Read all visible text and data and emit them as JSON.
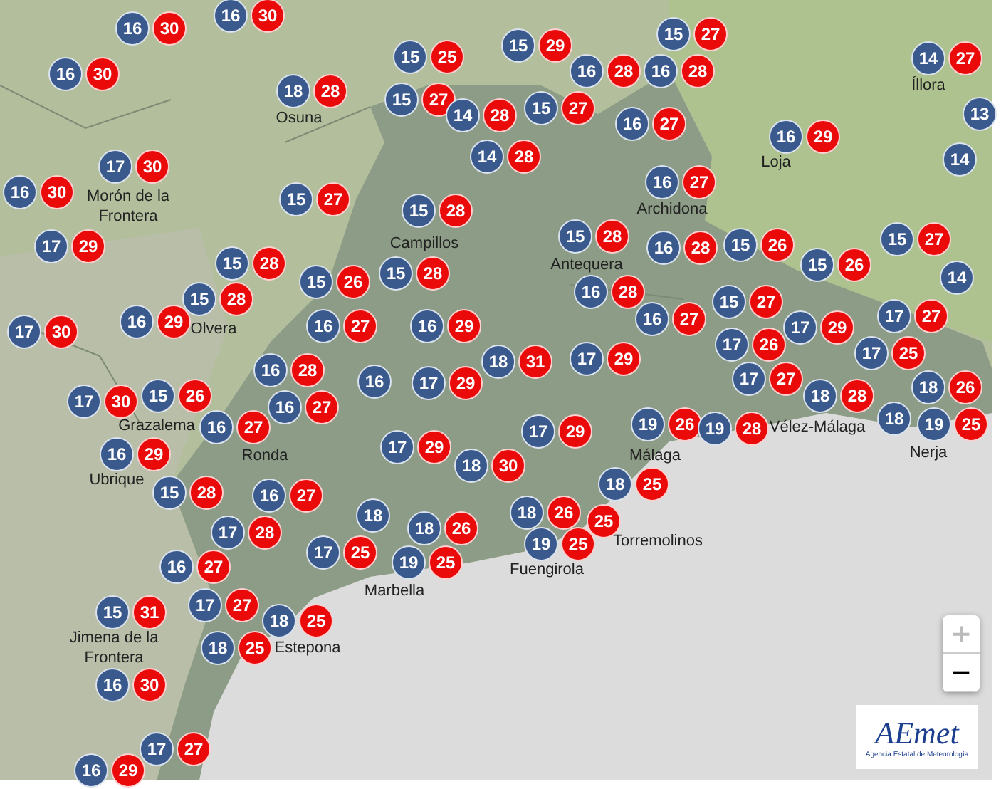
{
  "stations": [
    {
      "min": "16",
      "max": "30"
    },
    {
      "min": "16",
      "max": "30"
    },
    {
      "min": "16",
      "max": "30"
    },
    {
      "min": "18",
      "max": "28"
    },
    {
      "min": "15",
      "max": "25"
    },
    {
      "min": "15",
      "max": "29"
    },
    {
      "min": "15",
      "max": "27"
    },
    {
      "min": "16",
      "max": "28"
    },
    {
      "min": "16",
      "max": "28"
    },
    {
      "min": "15",
      "max": "27"
    },
    {
      "min": "14",
      "max": "28"
    },
    {
      "min": "15",
      "max": "27"
    },
    {
      "min": "16",
      "max": "27"
    },
    {
      "min": "14",
      "max": "28"
    },
    {
      "min": "14",
      "max": "27"
    },
    {
      "min": "13"
    },
    {
      "min": "16",
      "max": "29"
    },
    {
      "min": "14"
    },
    {
      "min": "17",
      "max": "30"
    },
    {
      "min": "16",
      "max": "30"
    },
    {
      "min": "15",
      "max": "27"
    },
    {
      "min": "16",
      "max": "27"
    },
    {
      "min": "15",
      "max": "28"
    },
    {
      "min": "15",
      "max": "28"
    },
    {
      "min": "17",
      "max": "29"
    },
    {
      "min": "15",
      "max": "28"
    },
    {
      "min": "15",
      "max": "28"
    },
    {
      "min": "15",
      "max": "28"
    },
    {
      "min": "15",
      "max": "26"
    },
    {
      "min": "16",
      "max": "28"
    },
    {
      "min": "15",
      "max": "26"
    },
    {
      "min": "15",
      "max": "26"
    },
    {
      "min": "15",
      "max": "27"
    },
    {
      "min": "14"
    },
    {
      "min": "16",
      "max": "28"
    },
    {
      "min": "16",
      "max": "27"
    },
    {
      "min": "15",
      "max": "27"
    },
    {
      "min": "17",
      "max": "30"
    },
    {
      "min": "16",
      "max": "29"
    },
    {
      "min": "16",
      "max": "27"
    },
    {
      "min": "16",
      "max": "29"
    },
    {
      "min": "17",
      "max": "26"
    },
    {
      "min": "17",
      "max": "29"
    },
    {
      "min": "17",
      "max": "27"
    },
    {
      "min": "17",
      "max": "25"
    },
    {
      "min": "17",
      "max": "27"
    },
    {
      "min": "18",
      "max": "28"
    },
    {
      "min": "18",
      "max": "26"
    },
    {
      "min": "18"
    },
    {
      "min": "19",
      "max": "25"
    },
    {
      "min": "18",
      "max": "31"
    },
    {
      "min": "17",
      "max": "29"
    },
    {
      "min": "16",
      "max": "28"
    },
    {
      "min": "16"
    },
    {
      "min": "17",
      "max": "29"
    },
    {
      "min": "17",
      "max": "30"
    },
    {
      "min": "15",
      "max": "26"
    },
    {
      "min": "16",
      "max": "27"
    },
    {
      "min": "16",
      "max": "27"
    },
    {
      "min": "16",
      "max": "29"
    },
    {
      "min": "19",
      "max": "26"
    },
    {
      "min": "19",
      "max": "28"
    },
    {
      "min": "17",
      "max": "29"
    },
    {
      "min": "18",
      "max": "30"
    },
    {
      "min": "17",
      "max": "29"
    },
    {
      "min": "15",
      "max": "28"
    },
    {
      "min": "16",
      "max": "27"
    },
    {
      "min": "17",
      "max": "28"
    },
    {
      "min": "16",
      "max": "27"
    },
    {
      "min": "18"
    },
    {
      "min": "18",
      "max": "26"
    },
    {
      "min": "17",
      "max": "25"
    },
    {
      "min": "19",
      "max": "25"
    },
    {
      "min": "18",
      "max": "26"
    },
    {
      "min": "18",
      "max": "25"
    },
    {
      "max": "25"
    },
    {
      "min": "19",
      "max": "25"
    },
    {
      "min": "15",
      "max": "31"
    },
    {
      "min": "17",
      "max": "27"
    },
    {
      "min": "18",
      "max": "25"
    },
    {
      "min": "18",
      "max": "25"
    },
    {
      "min": "16",
      "max": "30"
    },
    {
      "min": "17",
      "max": "27"
    },
    {
      "min": "16",
      "max": "29"
    }
  ],
  "places": [
    {
      "name": "Osuna"
    },
    {
      "name": "Morón de la Frontera"
    },
    {
      "name": "Campillos"
    },
    {
      "name": "Antequera"
    },
    {
      "name": "Archidona"
    },
    {
      "name": "Loja"
    },
    {
      "name": "Íllora"
    },
    {
      "name": "Olvera"
    },
    {
      "name": "Grazalema"
    },
    {
      "name": "Ronda"
    },
    {
      "name": "Ubrique"
    },
    {
      "name": "Málaga"
    },
    {
      "name": "Vélez-Málaga"
    },
    {
      "name": "Nerja"
    },
    {
      "name": "Torremolinos"
    },
    {
      "name": "Fuengirola"
    },
    {
      "name": "Marbella"
    },
    {
      "name": "Jimena de la Frontera"
    },
    {
      "name": "Estepona"
    }
  ],
  "zoom_controls": [
    {
      "label": "+",
      "disabled": true
    },
    {
      "label": "−",
      "disabled": false
    }
  ],
  "logo": {
    "wordmark": "AEmet",
    "tagline": "Agencia Estatal de Meteorología"
  }
}
